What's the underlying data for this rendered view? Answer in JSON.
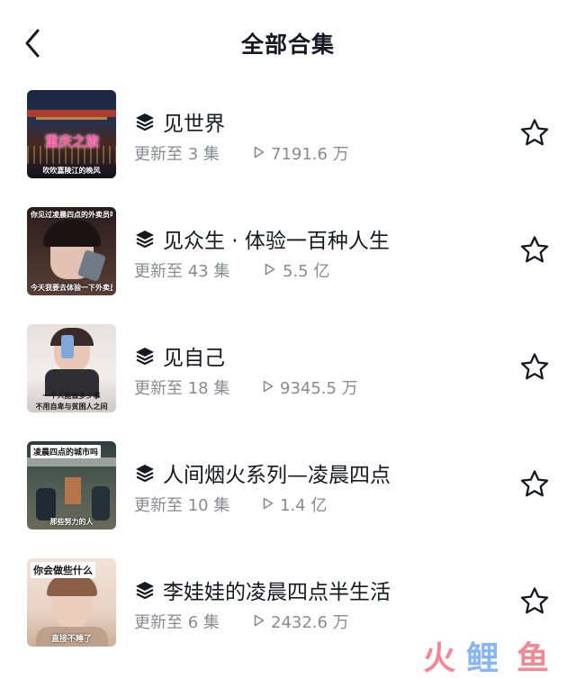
{
  "header": {
    "title": "全部合集",
    "back_icon": "chevron-left-icon"
  },
  "collections": [
    {
      "name": "见世界",
      "updated": "更新至 3 集",
      "views": "7191.6 万",
      "thumb": {
        "big": "重庆之旅",
        "bottom": "吹吹嘉陵江的晚风",
        "palette": [
          "#1f2a44",
          "#3a2020",
          "#c84a2a"
        ]
      }
    },
    {
      "name": "见众生 · 体验一百种人生",
      "updated": "更新至 43 集",
      "views": "5.5 亿",
      "thumb": {
        "top": "你见过凌晨四点的外卖员吗",
        "bottom": "今天我要去体验一下外卖员的生活",
        "palette": [
          "#2b1d1d",
          "#6b4a3e",
          "#d9b7a3"
        ]
      }
    },
    {
      "name": "见自己",
      "updated": "更新至 18 集",
      "views": "9345.5 万",
      "thumb": {
        "mid": "一个人能做多少事",
        "bottom": "不用自卑与贫困人之间",
        "palette": [
          "#d7d2cf",
          "#efe8e4",
          "#7f8aa8"
        ]
      }
    },
    {
      "name": "人间烟火系列—凌晨四点",
      "updated": "更新至 10 集",
      "views": "1.4 亿",
      "thumb": {
        "tag": "凌晨四点的城市吗",
        "bottom": "那些努力的人",
        "palette": [
          "#2a3b3a",
          "#5e6b60",
          "#b08a5a"
        ]
      }
    },
    {
      "name": "李娃娃的凌晨四点半生活",
      "updated": "更新至 6 集",
      "views": "2432.6 万",
      "thumb": {
        "tag": "你会做些什么",
        "bottom": "直接不睡了",
        "palette": [
          "#e9d6c8",
          "#c9a58c",
          "#8c6a55"
        ]
      }
    }
  ],
  "icons": {
    "series": "layers-icon",
    "play": "play-icon",
    "favorite": "star-outline-icon"
  },
  "colors": {
    "text": "#161823",
    "secondary": "#8a8b91",
    "watermark_red": "#e8283b",
    "watermark_blue": "#2a7be4"
  }
}
